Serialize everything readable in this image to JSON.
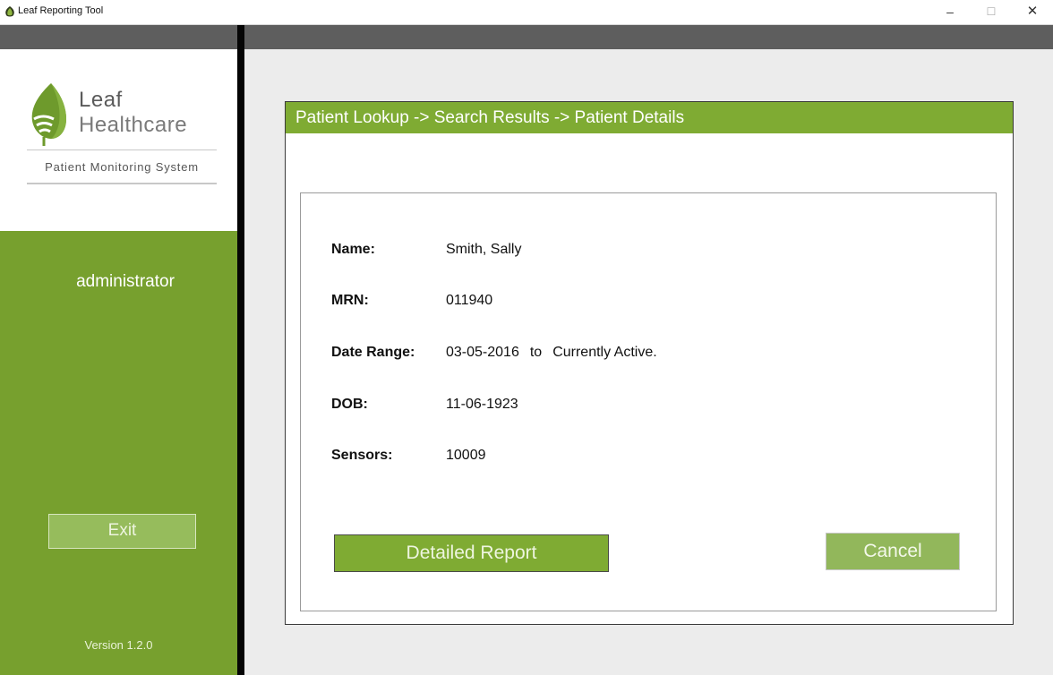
{
  "window": {
    "title": "Leaf Reporting Tool",
    "minimize_glyph": "–",
    "maximize_glyph": "☐",
    "close_glyph": "✕"
  },
  "sidebar": {
    "logo_line1": "Leaf",
    "logo_line2": "Healthcare",
    "tagline": "Patient Monitoring System",
    "username": "administrator",
    "exit_label": "Exit",
    "version": "Version 1.2.0"
  },
  "main": {
    "breadcrumb": "Patient Lookup -> Search Results -> Patient Details",
    "fields": {
      "name_label": "Name:",
      "name_value": "Smith, Sally",
      "mrn_label": "MRN:",
      "mrn_value": "011940",
      "range_label": "Date Range:",
      "range_start": "03-05-2016",
      "range_to": "to",
      "range_end": "Currently Active.",
      "dob_label": "DOB:",
      "dob_value": "11-06-1923",
      "sensors_label": "Sensors:",
      "sensors_value": "10009"
    },
    "report_button": "Detailed Report",
    "cancel_button": "Cancel"
  },
  "colors": {
    "brand_green": "#77a02e",
    "header_green": "#7fab33",
    "button_green_light": "#92b75b"
  },
  "icons": {
    "app": "leaf-icon",
    "logo": "leaf-logo-icon"
  }
}
